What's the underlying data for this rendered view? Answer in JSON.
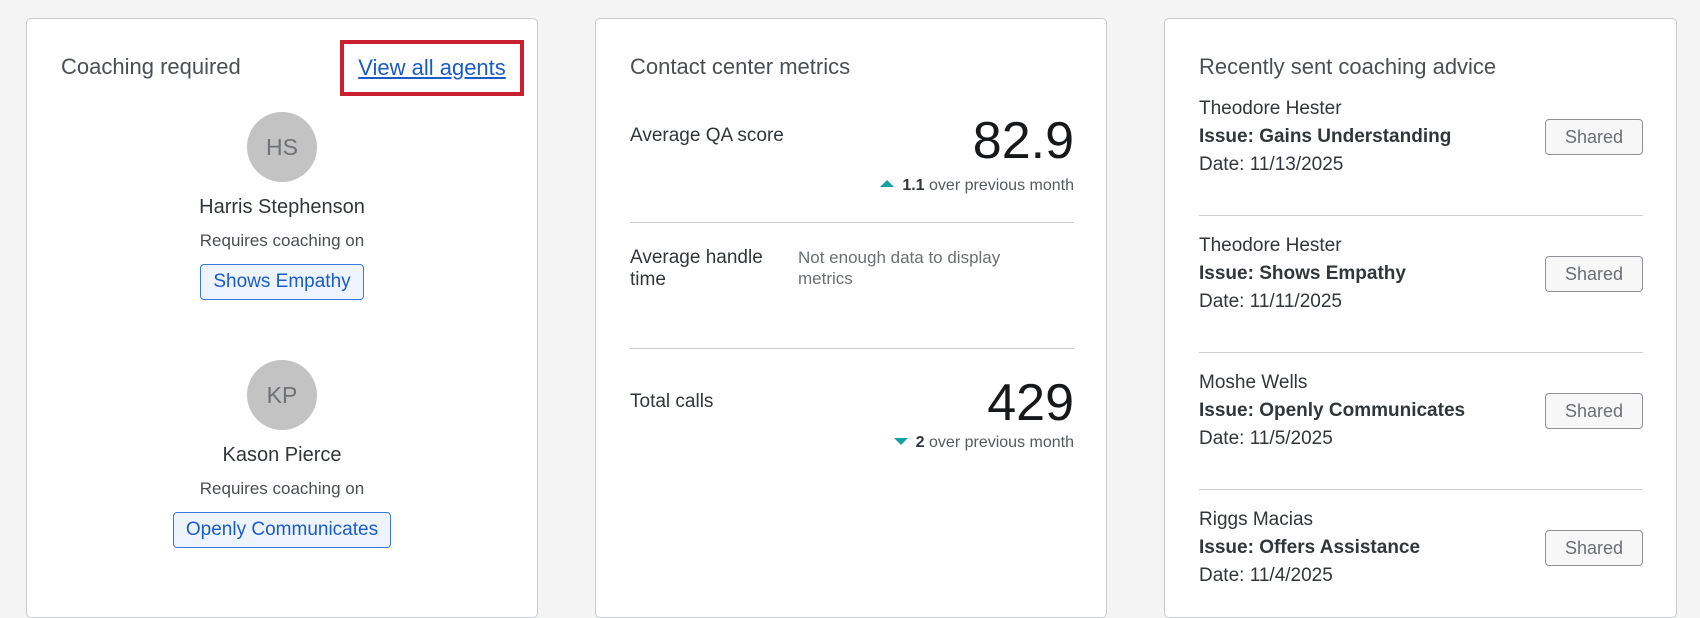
{
  "coaching": {
    "title": "Coaching required",
    "view_all_label": "View all agents",
    "agents": [
      {
        "initials": "HS",
        "name": "Harris Stephenson",
        "requires_label": "Requires coaching on",
        "skill": "Shows Empathy"
      },
      {
        "initials": "KP",
        "name": "Kason Pierce",
        "requires_label": "Requires coaching on",
        "skill": "Openly Communicates"
      }
    ]
  },
  "metrics": {
    "title": "Contact center metrics",
    "qa": {
      "label": "Average QA score",
      "value": "82.9",
      "delta": "1.1",
      "delta_text": "over previous month",
      "direction": "up"
    },
    "handle": {
      "label": "Average handle time",
      "message": "Not enough data to display metrics"
    },
    "calls": {
      "label": "Total calls",
      "value": "429",
      "delta": "2",
      "delta_text": "over previous month",
      "direction": "down"
    }
  },
  "advice": {
    "title": "Recently sent coaching advice",
    "items": [
      {
        "name": "Theodore Hester",
        "issue": "Issue: Gains Understanding",
        "date": "Date: 11/13/2025",
        "status": "Shared"
      },
      {
        "name": "Theodore Hester",
        "issue": "Issue: Shows Empathy",
        "date": "Date: 11/11/2025",
        "status": "Shared"
      },
      {
        "name": "Moshe Wells",
        "issue": "Issue: Openly Communicates",
        "date": "Date: 11/5/2025",
        "status": "Shared"
      },
      {
        "name": "Riggs Macias",
        "issue": "Issue: Offers Assistance",
        "date": "Date: 11/4/2025",
        "status": "Shared"
      }
    ]
  },
  "colors": {
    "highlight_border": "#c8202f",
    "link": "#1a5cc7",
    "trend_arrow": "#14a3a0"
  }
}
